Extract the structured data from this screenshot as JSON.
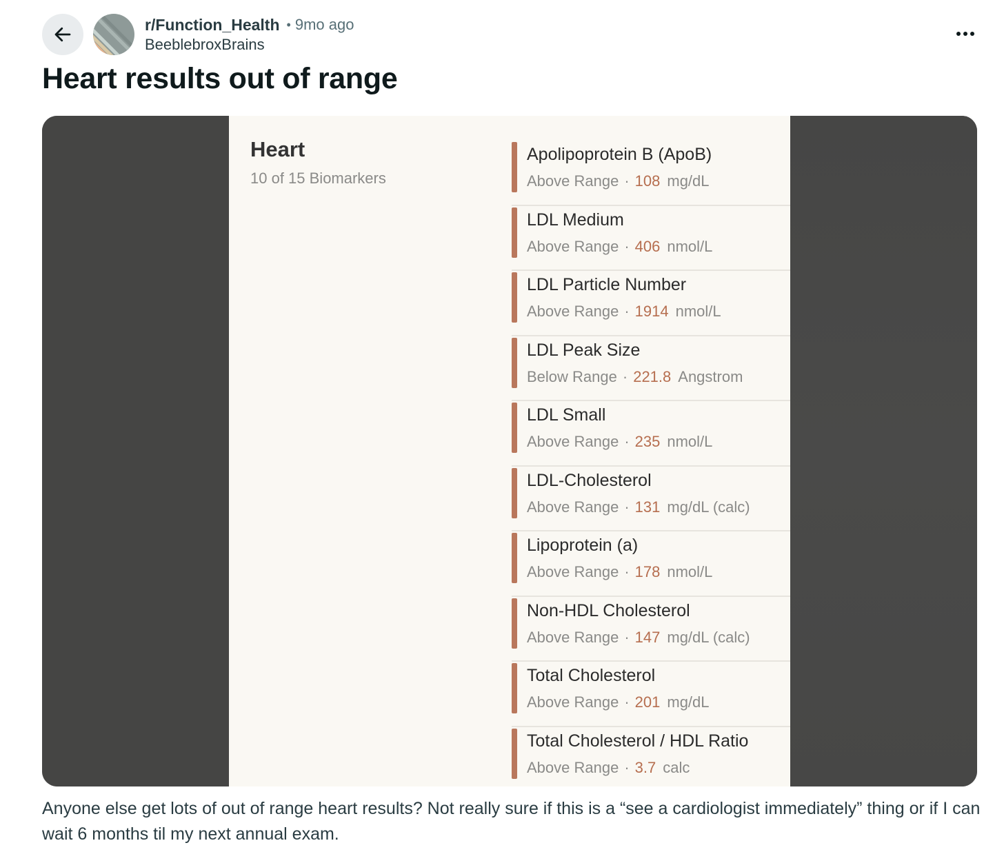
{
  "post": {
    "subreddit": "r/Function_Health",
    "separator": "•",
    "time_ago": "9mo ago",
    "author": "BeeblebroxBrains",
    "title": "Heart results out of range",
    "body": "Anyone else get lots of out of range heart results? Not really sure if this is a “see a cardiologist immediately” thing or if I can wait 6 months til my next annual exam."
  },
  "icons": {
    "back": "arrow-left-icon",
    "more": "more-horizontal-icon",
    "avatar": "subreddit-avatar"
  },
  "colors": {
    "accent_bar": "#b9775c",
    "value": "#b66e4f",
    "panel_bg": "#faf8f3",
    "media_bg": "#474746"
  },
  "image": {
    "heading": "Heart",
    "subheading": "10 of 15 Biomarkers",
    "biomarkers": [
      {
        "name": "Apolipoprotein B (ApoB)",
        "status": "Above Range",
        "dot": "·",
        "value": "108",
        "unit": "mg/dL"
      },
      {
        "name": "LDL Medium",
        "status": "Above Range",
        "dot": "·",
        "value": "406",
        "unit": "nmol/L"
      },
      {
        "name": "LDL Particle Number",
        "status": "Above Range",
        "dot": "·",
        "value": "1914",
        "unit": "nmol/L"
      },
      {
        "name": "LDL Peak Size",
        "status": "Below Range",
        "dot": "·",
        "value": "221.8",
        "unit": "Angstrom"
      },
      {
        "name": "LDL Small",
        "status": "Above Range",
        "dot": "·",
        "value": "235",
        "unit": "nmol/L"
      },
      {
        "name": "LDL-Cholesterol",
        "status": "Above Range",
        "dot": "·",
        "value": "131",
        "unit": "mg/dL (calc)"
      },
      {
        "name": "Lipoprotein (a)",
        "status": "Above Range",
        "dot": "·",
        "value": "178",
        "unit": "nmol/L"
      },
      {
        "name": "Non-HDL Cholesterol",
        "status": "Above Range",
        "dot": "·",
        "value": "147",
        "unit": "mg/dL (calc)"
      },
      {
        "name": "Total Cholesterol",
        "status": "Above Range",
        "dot": "·",
        "value": "201",
        "unit": "mg/dL"
      },
      {
        "name": "Total Cholesterol / HDL Ratio",
        "status": "Above Range",
        "dot": "·",
        "value": "3.7",
        "unit": "calc"
      }
    ]
  }
}
